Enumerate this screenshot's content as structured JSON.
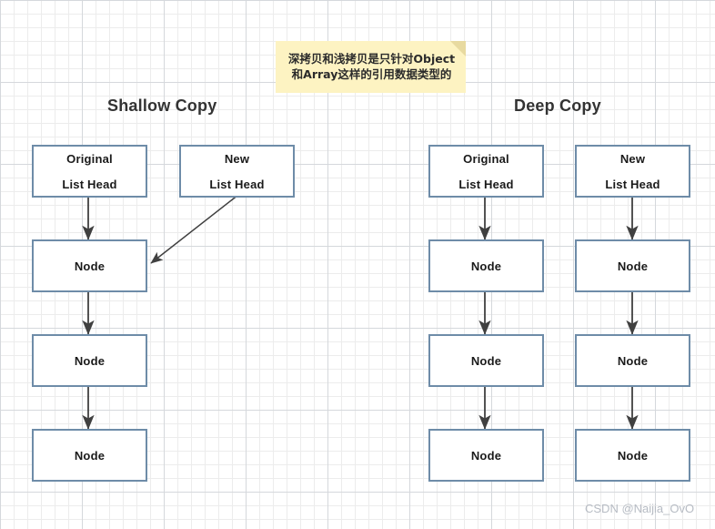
{
  "diagram": {
    "watermark": "CSDN @Naijia_OvO",
    "note": {
      "line1": "深拷贝和浅拷贝是只针对Object",
      "line2": "和Array这样的引用数据类型的"
    },
    "colors": {
      "box_border": "#6e8ca8",
      "box_fill": "#ffffff",
      "arrow": "#404040",
      "note_fill": "#fdf3c2",
      "note_fold": "#e8daa0",
      "grid_minor": "#ececec",
      "grid_major": "#d5d8dc",
      "title_text": "#333333",
      "watermark_text": "#b7bcc4"
    },
    "sections": [
      {
        "id": "shallow",
        "title": "Shallow Copy",
        "columns": [
          {
            "id": "original",
            "head": {
              "line1": "Original",
              "line2": "List Head"
            },
            "nodes": [
              "Node",
              "Node",
              "Node"
            ]
          },
          {
            "id": "new",
            "head": {
              "line1": "New",
              "line2": "List Head"
            },
            "nodes": []
          }
        ]
      },
      {
        "id": "deep",
        "title": "Deep Copy",
        "columns": [
          {
            "id": "original",
            "head": {
              "line1": "Original",
              "line2": "List Head"
            },
            "nodes": [
              "Node",
              "Node",
              "Node"
            ]
          },
          {
            "id": "new",
            "head": {
              "line1": "New",
              "line2": "List Head"
            },
            "nodes": [
              "Node",
              "Node",
              "Node"
            ]
          }
        ]
      }
    ]
  }
}
